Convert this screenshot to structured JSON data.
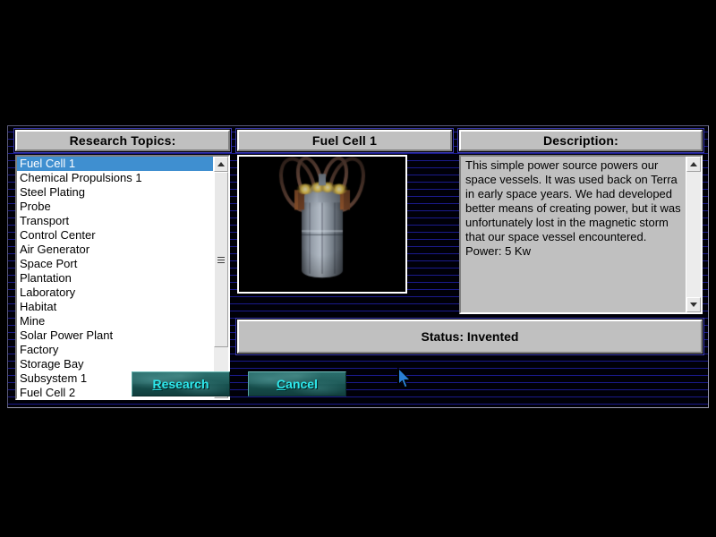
{
  "window": {
    "background_color": "#000008",
    "scanline_color": "#1a1a8c"
  },
  "headers": {
    "topics": "Research Topics:",
    "item": "Fuel Cell 1",
    "description": "Description:"
  },
  "topics": {
    "selected_index": 0,
    "selected_color": "#3f8fd0",
    "items": [
      "Fuel Cell 1",
      "Chemical Propulsions 1",
      "Steel Plating",
      "Probe",
      "Transport",
      "Control Center",
      "Air Generator",
      "Space Port",
      "Plantation",
      "Laboratory",
      "Habitat",
      "Mine",
      "Solar Power Plant",
      "Factory",
      "Storage Bay",
      "Subsystem 1",
      "Fuel Cell 2"
    ]
  },
  "picture": {
    "alt": "Fuel Cell 1 three-dimensional render: grey cylindrical tank with copper coil tubes and glowing yellow lamps"
  },
  "description": {
    "text": "This simple power source powers our space vessels.  It was used back on Terra in early space years. We had developed better means of creating power, but it was unfortunately lost in the magnetic storm that our space vessel encountered.  Power: 5 Kw"
  },
  "status": {
    "text": "Status: Invented"
  },
  "buttons": {
    "research": {
      "accel": "R",
      "rest": "esearch"
    },
    "cancel": {
      "accel": "C",
      "rest": "ancel"
    },
    "text_color": "#2ee8ec"
  },
  "scrollbars": {
    "up_icon": "arrow-up-icon",
    "down_icon": "arrow-down-icon"
  },
  "cursor": {
    "icon": "mouse-pointer-icon"
  }
}
